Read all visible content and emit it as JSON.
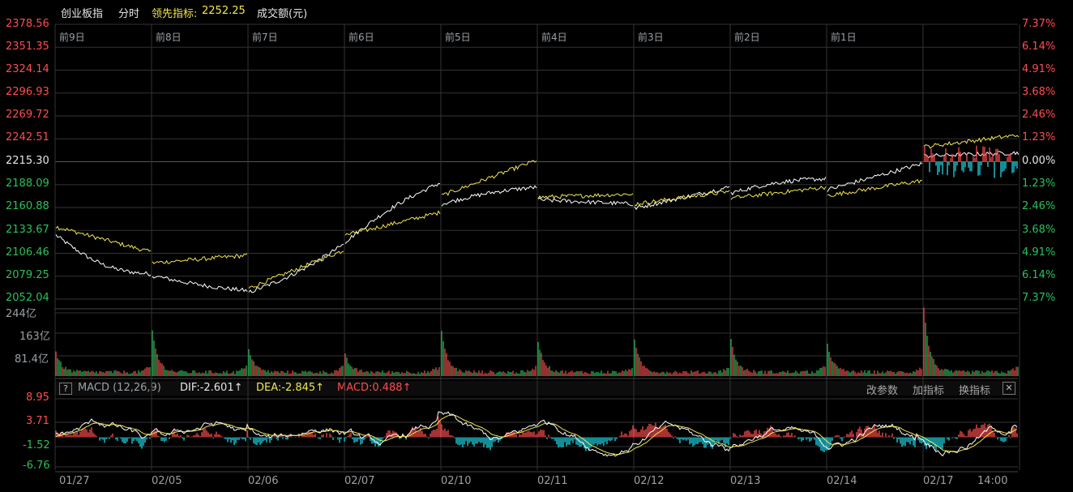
{
  "header": {
    "index_name": "创业板指",
    "mode": "分时",
    "leading_label": "领先指标:",
    "leading_value": "2252.25",
    "volume_label": "成交额(元)"
  },
  "colors": {
    "up": "#ff4d4d",
    "down": "#29c25a",
    "price": "#ffffff",
    "leading": "#f2e64d",
    "grid": "#333333",
    "macd_neg": "#1fd8e8"
  },
  "chart_data": [
    {
      "type": "line",
      "title": "",
      "y_left_ticks": [
        "2378.56",
        "2351.35",
        "2324.14",
        "2296.93",
        "2269.72",
        "2242.51",
        "2215.30",
        "2188.09",
        "2160.88",
        "2133.67",
        "2106.46",
        "2079.25",
        "2052.04"
      ],
      "y_right_ticks": [
        "7.37%",
        "6.14%",
        "4.91%",
        "3.68%",
        "2.46%",
        "1.23%",
        "0.00%",
        "1.23%",
        "2.46%",
        "3.68%",
        "4.91%",
        "6.14%",
        "7.37%"
      ],
      "ylim": [
        2052.04,
        2378.56
      ],
      "reference": 2215.3,
      "day_labels": [
        "前9日",
        "前8日",
        "前7日",
        "前6日",
        "前5日",
        "前4日",
        "前3日",
        "前2日",
        "前1日"
      ],
      "x_ticks": [
        "01/27",
        "02/05",
        "02/06",
        "02/07",
        "02/10",
        "02/11",
        "02/12",
        "02/13",
        "02/14",
        "02/17",
        "14:00"
      ],
      "days": [
        {
          "price_start": 2128,
          "price_end": 2082,
          "price_min": 2070,
          "lead_start": 2138,
          "lead_end": 2108
        },
        {
          "price_start": 2080,
          "price_end": 2062,
          "price_min": 2060,
          "lead_start": 2095,
          "lead_end": 2104
        },
        {
          "price_start": 2060,
          "price_end": 2117,
          "price_min": 2055,
          "lead_start": 2065,
          "lead_end": 2110
        },
        {
          "price_start": 2120,
          "price_end": 2190,
          "price_max": 2196,
          "lead_start": 2128,
          "lead_end": 2155
        },
        {
          "price_start": 2165,
          "price_end": 2185,
          "price_max": 2188,
          "lead_start": 2175,
          "lead_end": 2217
        },
        {
          "price_start": 2170,
          "price_end": 2165,
          "lead_start": 2173,
          "lead_end": 2177
        },
        {
          "price_start": 2160,
          "price_end": 2185,
          "lead_start": 2165,
          "lead_end": 2180
        },
        {
          "price_start": 2178,
          "price_end": 2195,
          "price_max": 2199,
          "lead_start": 2172,
          "lead_end": 2185
        },
        {
          "price_start": 2182,
          "price_end": 2213,
          "lead_start": 2175,
          "lead_end": 2193
        },
        {
          "price_start": 2222,
          "price_end": 2226,
          "lead_start": 2233,
          "lead_end": 2247
        }
      ],
      "series": [
        {
          "name": "创业板指",
          "color": "#ffffff"
        },
        {
          "name": "领先指标",
          "color": "#f2e64d"
        }
      ]
    },
    {
      "type": "bar",
      "title": "成交额(元)",
      "y_ticks": [
        "244亿",
        "163亿",
        "81.4亿"
      ],
      "ylim": [
        0,
        244
      ],
      "unit": "亿",
      "open_spike_values": [
        76,
        156,
        91,
        64,
        154,
        120,
        116,
        120,
        108,
        242
      ]
    },
    {
      "type": "line",
      "title": "MACD (12,26,9)",
      "indicator_name": "MACD (12,26,9)",
      "dif_label": "DIF:-2.601↑",
      "dea_label": "DEA:-2.845↑",
      "macd_label": "MACD:0.488↑",
      "y_ticks": [
        "8.95",
        "3.71",
        "-1.52",
        "-6.76"
      ],
      "ylim": [
        -9,
        11
      ],
      "buttons": [
        "改参数",
        "加指标",
        "换指标"
      ],
      "close_symbol": "✕",
      "help_symbol": "?"
    }
  ]
}
